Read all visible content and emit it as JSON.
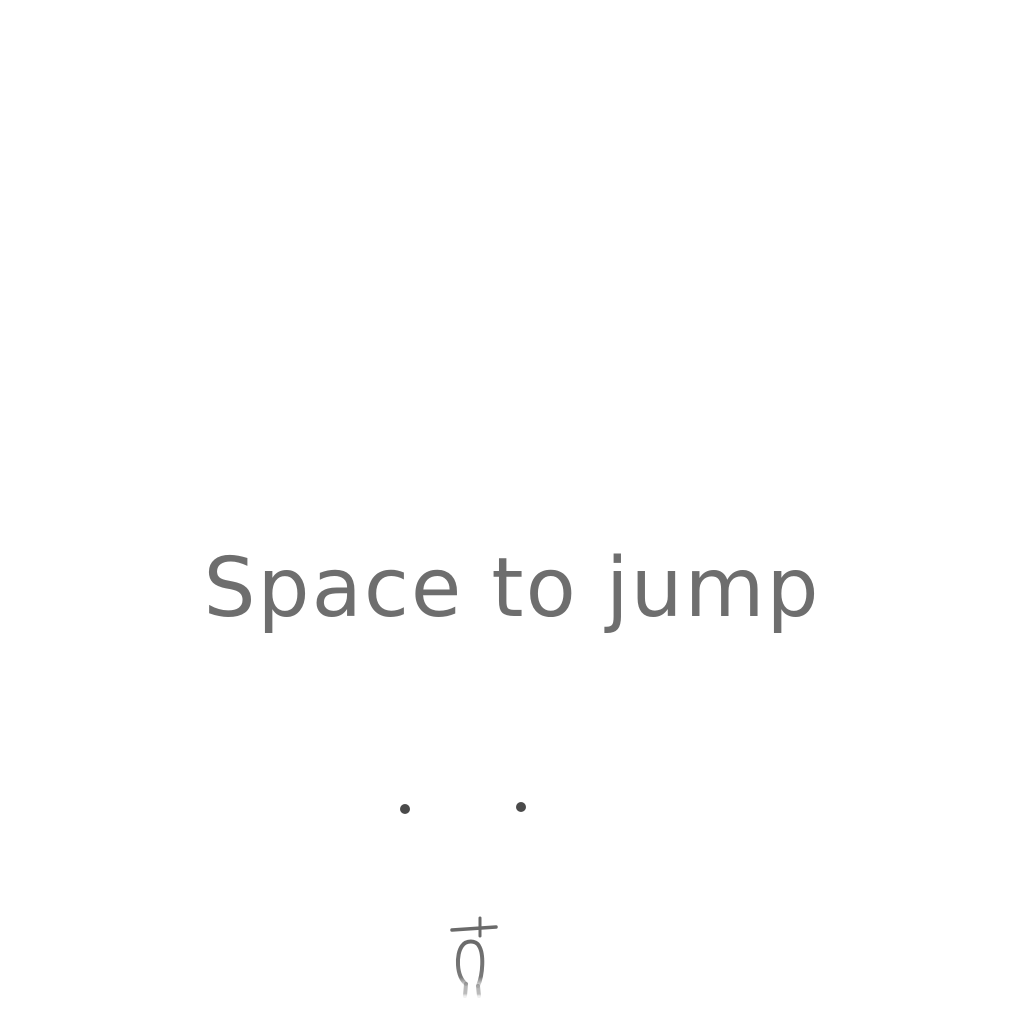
{
  "game": {
    "instruction_text": "Space to jump"
  },
  "colors": {
    "background": "#ffffff",
    "text": "#6e6e6e",
    "pips": "#4a4a4a",
    "player_stroke": "#6a6a6a"
  },
  "icons": {
    "player": "stick-player-icon"
  }
}
